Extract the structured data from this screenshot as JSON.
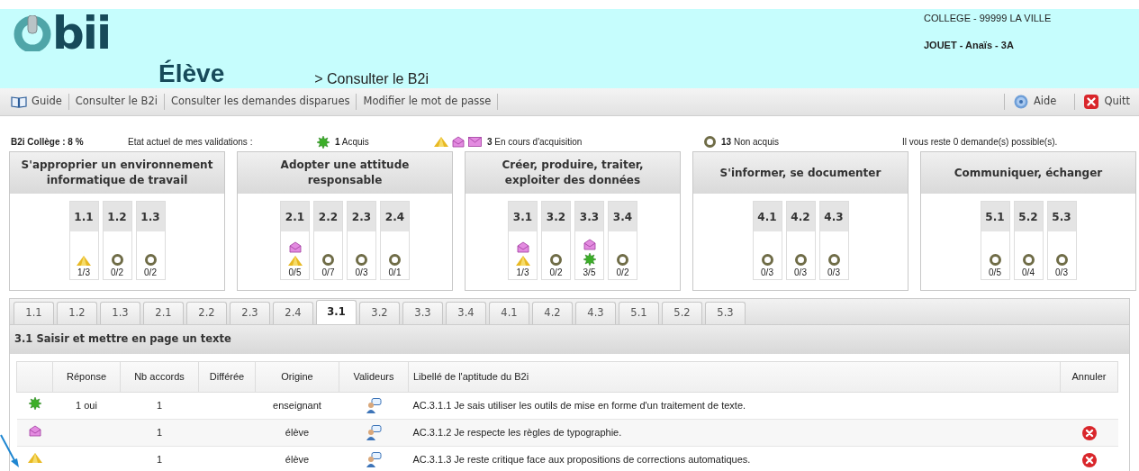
{
  "header": {
    "logo": "bii",
    "role": "Élève",
    "breadcrumb": "> Consulter le B2i",
    "school": "COLLEGE - 99999 LA VILLE",
    "student": "JOUET - Anaïs - 3A"
  },
  "nav": {
    "left": [
      {
        "label": "Guide"
      },
      {
        "label": "Consulter le B2i"
      },
      {
        "label": "Consulter les demandes disparues"
      },
      {
        "label": "Modifier le mot de passe"
      }
    ],
    "right": [
      {
        "label": "Aide"
      },
      {
        "label": "Quitt"
      }
    ]
  },
  "summary": {
    "score": "B2i Collège : 8 %",
    "state_label": "Etat actuel de mes validations :",
    "groups": [
      {
        "icons": [
          {
            "kind": "acquis"
          }
        ],
        "text": "**1** Acquis"
      },
      {
        "icons": [
          {
            "kind": "en_cours"
          },
          {
            "kind": "demande"
          },
          {
            "kind": "envoye"
          }
        ],
        "text": "**3** En cours d'acquisition"
      },
      {
        "icons": [
          {
            "kind": "non_acquis"
          }
        ],
        "text": "**13** Non acquis"
      }
    ],
    "remaining": "Il vous reste 0 demande(s) possible(s)."
  },
  "domains": [
    {
      "title": "S'approprier un environnement informatique de travail",
      "items": [
        {
          "code": "1.1",
          "icons": [
            {
              "kind": "en_cours"
            }
          ],
          "score": "1/3"
        },
        {
          "code": "1.2",
          "icons": [
            {
              "kind": "non_acquis"
            }
          ],
          "score": "0/2"
        },
        {
          "code": "1.3",
          "icons": [
            {
              "kind": "non_acquis"
            }
          ],
          "score": "0/2"
        }
      ]
    },
    {
      "title": "Adopter une attitude responsable",
      "items": [
        {
          "code": "2.1",
          "icons": [
            {
              "kind": "demande"
            },
            {
              "kind": "en_cours"
            }
          ],
          "score": "0/5"
        },
        {
          "code": "2.2",
          "icons": [
            {
              "kind": "non_acquis"
            }
          ],
          "score": "0/7"
        },
        {
          "code": "2.3",
          "icons": [
            {
              "kind": "non_acquis"
            }
          ],
          "score": "0/3"
        },
        {
          "code": "2.4",
          "icons": [
            {
              "kind": "non_acquis"
            }
          ],
          "score": "0/1"
        }
      ]
    },
    {
      "title": "Créer, produire, traiter, exploiter des données",
      "items": [
        {
          "code": "3.1",
          "icons": [
            {
              "kind": "demande"
            },
            {
              "kind": "en_cours"
            }
          ],
          "score": "1/3"
        },
        {
          "code": "3.2",
          "icons": [
            {
              "kind": "non_acquis"
            }
          ],
          "score": "0/2"
        },
        {
          "code": "3.3",
          "icons": [
            {
              "kind": "demande"
            },
            {
              "kind": "acquis"
            }
          ],
          "score": "3/5"
        },
        {
          "code": "3.4",
          "icons": [
            {
              "kind": "non_acquis"
            }
          ],
          "score": "0/2"
        }
      ]
    },
    {
      "title": "S'informer, se documenter",
      "items": [
        {
          "code": "4.1",
          "icons": [
            {
              "kind": "non_acquis"
            }
          ],
          "score": "0/3"
        },
        {
          "code": "4.2",
          "icons": [
            {
              "kind": "non_acquis"
            }
          ],
          "score": "0/3"
        },
        {
          "code": "4.3",
          "icons": [
            {
              "kind": "non_acquis"
            }
          ],
          "score": "0/3"
        }
      ]
    },
    {
      "title": "Communiquer, échanger",
      "items": [
        {
          "code": "5.1",
          "icons": [
            {
              "kind": "non_acquis"
            }
          ],
          "score": "0/5"
        },
        {
          "code": "5.2",
          "icons": [
            {
              "kind": "non_acquis"
            }
          ],
          "score": "0/4"
        },
        {
          "code": "5.3",
          "icons": [
            {
              "kind": "non_acquis"
            }
          ],
          "score": "0/3"
        }
      ]
    }
  ],
  "tabs": [
    {
      "label": "1.1",
      "selected": false
    },
    {
      "label": "1.2",
      "selected": false
    },
    {
      "label": "1.3",
      "selected": false
    },
    {
      "label": "2.1",
      "selected": false
    },
    {
      "label": "2.2",
      "selected": false
    },
    {
      "label": "2.3",
      "selected": false
    },
    {
      "label": "2.4",
      "selected": false
    },
    {
      "label": "3.1",
      "selected": true
    },
    {
      "label": "3.2",
      "selected": false
    },
    {
      "label": "3.3",
      "selected": false
    },
    {
      "label": "3.4",
      "selected": false
    },
    {
      "label": "4.1",
      "selected": false
    },
    {
      "label": "4.2",
      "selected": false
    },
    {
      "label": "4.3",
      "selected": false
    },
    {
      "label": "5.1",
      "selected": false
    },
    {
      "label": "5.2",
      "selected": false
    },
    {
      "label": "5.3",
      "selected": false
    }
  ],
  "section_title": "3.1 Saisir et mettre en page un texte",
  "table": {
    "columns": [
      "Réponse",
      "Nb accords",
      "Différée",
      "Origine",
      "Valideurs",
      "Libellé de l'aptitude du B2i",
      "Annuler"
    ],
    "rows": [
      {
        "kind": "acquis",
        "reponse": "1 oui",
        "accords": "1",
        "origine": "enseignant",
        "libelle": "AC.3.1.1 Je sais utiliser les outils de mise en forme d'un traitement de texte.",
        "cancelable": false
      },
      {
        "kind": "demande",
        "accords": "1",
        "origine": "élève",
        "libelle": "AC.3.1.2 Je respecte les règles de typographie.",
        "cancelable": true
      },
      {
        "kind": "en_cours",
        "accords": "1",
        "origine": "élève",
        "libelle": "AC.3.1.3 Je reste critique face aux propositions de corrections automatiques.",
        "cancelable": true
      }
    ]
  }
}
